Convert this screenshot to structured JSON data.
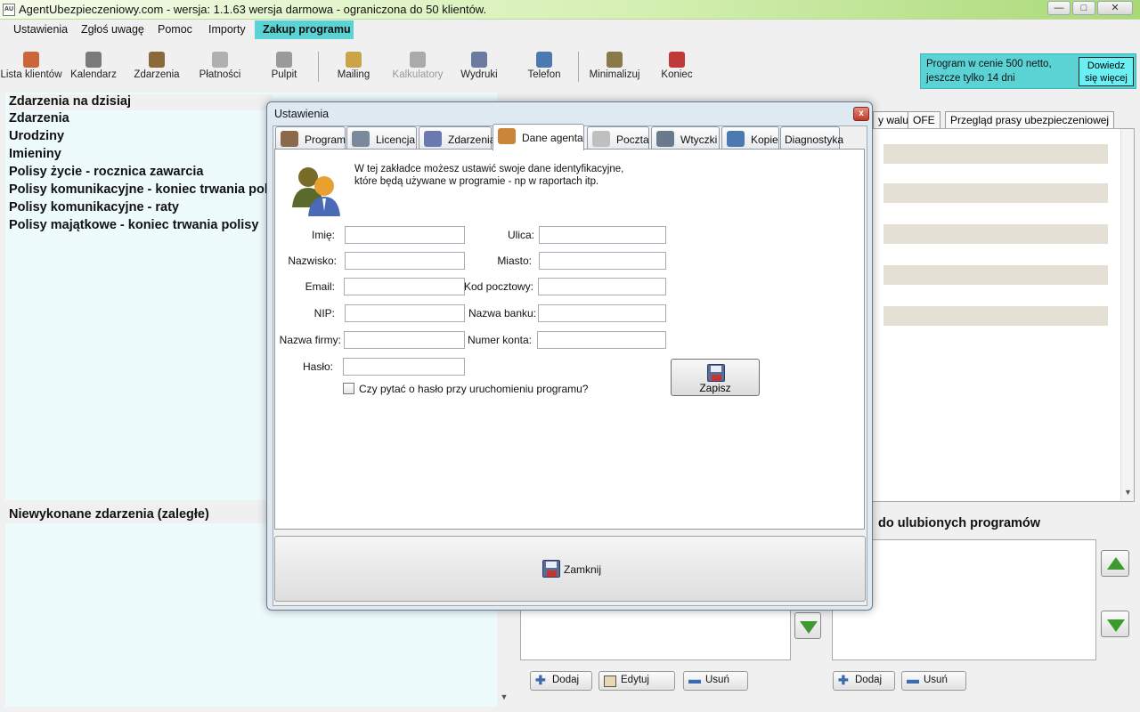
{
  "window": {
    "title": "AgentUbezpieczeniowy.com - wersja: 1.1.63 wersja darmowa - ograniczona do 50 klientów.",
    "logo_text": "AU",
    "minimize": "—",
    "maximize": "□",
    "close": "✕"
  },
  "menu": [
    "Ustawienia",
    "Zgłoś uwagę",
    "Pomoc",
    "Importy",
    "Zakup programu"
  ],
  "toolbar": [
    {
      "label": "Lista klientów",
      "icon": "clients-icon",
      "color": "#c9673a",
      "enabled": true
    },
    {
      "label": "Kalendarz",
      "icon": "calendar-icon",
      "color": "#7a7a7a",
      "enabled": true
    },
    {
      "label": "Zdarzenia",
      "icon": "clock-icon",
      "color": "#8a6a3a",
      "enabled": true
    },
    {
      "label": "Płatności",
      "icon": "document-icon",
      "color": "#b0b0b0",
      "enabled": true
    },
    {
      "label": "Pulpit",
      "icon": "desktop-icon",
      "color": "#9a9a9a",
      "enabled": true
    },
    {
      "label": "Mailing",
      "icon": "mail-icon",
      "color": "#c9a44a",
      "enabled": true
    },
    {
      "label": "Kalkulatory",
      "icon": "calculator-icon",
      "color": "#aaaaaa",
      "enabled": false
    },
    {
      "label": "Wydruki",
      "icon": "printer-icon",
      "color": "#6a7aa0",
      "enabled": true
    },
    {
      "label": "Telefon",
      "icon": "phone-icon",
      "color": "#4a7ab0",
      "enabled": true
    },
    {
      "label": "Minimalizuj",
      "icon": "minimize-icon",
      "color": "#8a7a4a",
      "enabled": true
    },
    {
      "label": "Koniec",
      "icon": "exit-icon",
      "color": "#c03a3a",
      "enabled": true
    }
  ],
  "promo": {
    "text1": "Program w cenie 500 netto,",
    "text2": "jeszcze tylko 14 dni",
    "button_line1": "Dowiedz",
    "button_line2": "się więcej"
  },
  "left": {
    "heading": "Zdarzenia na dzisiaj",
    "events": [
      "Zdarzenia",
      "Urodziny",
      "Imieniny",
      "Polisy życie - rocznica zawarcia",
      "Polisy komunikacyjne - koniec trwania pol",
      "Polisy komunikacyjne - raty",
      "Polisy majątkowe - koniec trwania polisy"
    ],
    "overdue_title": "Niewykonane zdarzenia (zaległe)"
  },
  "right": {
    "tabs": [
      "y walut",
      "OFE",
      "Przegląd prasy ubezpieczeniowej"
    ],
    "fav_title": "do ulubionych programów",
    "buttons": {
      "add": "Dodaj",
      "edit": "Edytuj",
      "remove": "Usuń",
      "add2": "Dodaj",
      "remove2": "Usuń"
    },
    "scroll_down": "▼"
  },
  "dialog": {
    "title": "Ustawienia",
    "close": "x",
    "tabs": [
      {
        "label": "Program",
        "icon": "pencil-icon",
        "color": "#8a6a4a"
      },
      {
        "label": "Licencja",
        "icon": "license-icon",
        "color": "#7a8a9a"
      },
      {
        "label": "Zdarzenia",
        "icon": "events-icon",
        "color": "#6a7ab0"
      },
      {
        "label": "Dane agenta",
        "icon": "agent-icon",
        "color": "#c9863a"
      },
      {
        "label": "Poczta",
        "icon": "envelope-icon",
        "color": "#bfbfbf"
      },
      {
        "label": "Wtyczki",
        "icon": "plugin-icon",
        "color": "#6a7a8a"
      },
      {
        "label": "Kopie",
        "icon": "backup-icon",
        "color": "#4a7ab0"
      },
      {
        "label": "Diagnostyka",
        "icon": "",
        "color": "#ffffff"
      }
    ],
    "info_line1": "W tej zakładce możesz ustawić swoje dane identyfikacyjne,",
    "info_line2": "które będą używane w programie - np w raportach itp.",
    "fields_left": [
      {
        "label": "Imię:",
        "value": ""
      },
      {
        "label": "Nazwisko:",
        "value": ""
      },
      {
        "label": "Email:",
        "value": ""
      },
      {
        "label": "NIP:",
        "value": ""
      },
      {
        "label": "Nazwa firmy:",
        "value": ""
      },
      {
        "label": "Hasło:",
        "value": ""
      }
    ],
    "fields_right": [
      {
        "label": "Ulica:",
        "value": ""
      },
      {
        "label": "Miasto:",
        "value": ""
      },
      {
        "label": "Kod pocztowy:",
        "value": ""
      },
      {
        "label": "Nazwa banku:",
        "value": ""
      },
      {
        "label": "Numer konta:",
        "value": ""
      }
    ],
    "checkbox_label": "Czy pytać o  hasło przy uruchomieniu programu?",
    "checkbox_checked": false,
    "save_label": "Zapisz",
    "close_label": "Zamknij"
  }
}
